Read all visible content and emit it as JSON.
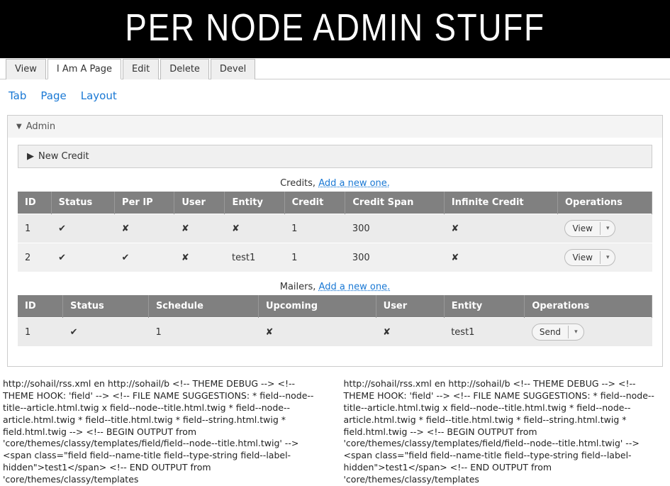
{
  "header": {
    "title": "PER NODE ADMIN STUFF"
  },
  "primary_tabs": {
    "view": "View",
    "iam": "I Am A Page",
    "edit": "Edit",
    "delete": "Delete",
    "devel": "Devel"
  },
  "secondary_tabs": {
    "tab": "Tab",
    "page": "Page",
    "layout": "Layout"
  },
  "admin_panel": {
    "label": "Admin",
    "new_credit_label": "New Credit",
    "credits_caption_prefix": "Credits, ",
    "credits_caption_link": "Add a new one.",
    "mailers_caption_prefix": "Mailers, ",
    "mailers_caption_link": "Add a new one."
  },
  "credits_table": {
    "headers": {
      "id": "ID",
      "status": "Status",
      "per_ip": "Per IP",
      "user": "User",
      "entity": "Entity",
      "credit": "Credit",
      "credit_span": "Credit Span",
      "infinite": "Infinite Credit",
      "ops": "Operations"
    },
    "rows": [
      {
        "id": "1",
        "status": "✔",
        "per_ip": "✘",
        "user": "✘",
        "entity": "✘",
        "credit": "1",
        "credit_span": "300",
        "infinite": "✘",
        "op": "View"
      },
      {
        "id": "2",
        "status": "✔",
        "per_ip": "✔",
        "user": "✘",
        "entity": "test1",
        "credit": "1",
        "credit_span": "300",
        "infinite": "✘",
        "op": "View"
      }
    ]
  },
  "mailers_table": {
    "headers": {
      "id": "ID",
      "status": "Status",
      "schedule": "Schedule",
      "upcoming": "Upcoming",
      "user": "User",
      "entity": "Entity",
      "ops": "Operations"
    },
    "rows": [
      {
        "id": "1",
        "status": "✔",
        "schedule": "1",
        "upcoming": "✘",
        "user": "✘",
        "entity": "test1",
        "op": "Send"
      }
    ]
  },
  "debug_text": "http://sohail/rss.xml en http://sohail/b <!-- THEME DEBUG --> <!-- THEME HOOK: 'field' --> <!-- FILE NAME SUGGESTIONS: * field--node--title--article.html.twig x field--node--title.html.twig * field--node--article.html.twig * field--title.html.twig * field--string.html.twig * field.html.twig --> <!-- BEGIN OUTPUT from 'core/themes/classy/templates/field/field--node--title.html.twig' --> <span class=\"field field--name-title field--type-string field--label-hidden\">test1</span> <!-- END OUTPUT from 'core/themes/classy/templates"
}
